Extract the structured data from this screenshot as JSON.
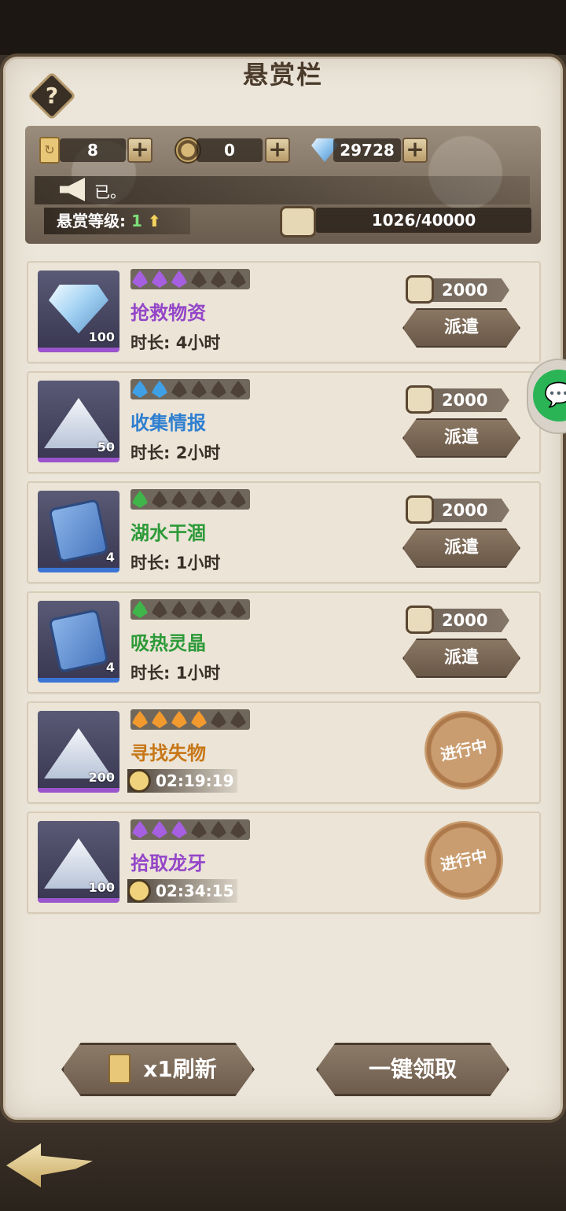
{
  "title": "悬赏栏",
  "help_label": "?",
  "resources": {
    "tickets": "8",
    "coins": "0",
    "gems": "29728",
    "plus": "+"
  },
  "notice": "已。",
  "level": {
    "label": "悬赏等级:",
    "value": "1",
    "arrow": "⬆"
  },
  "exp": "1026/40000",
  "duration_label": "时长:",
  "dispatch_label": "派遣",
  "in_progress_label": "进行中",
  "quests": [
    {
      "name": "抢救物资",
      "duration": "4小时",
      "reward": "2000",
      "qty": "100",
      "stars": 3,
      "star_color": "#a65fe0",
      "name_color": "#9446c8"
    },
    {
      "name": "收集情报",
      "duration": "2小时",
      "reward": "2000",
      "qty": "50",
      "stars": 2,
      "star_color": "#3fa0e6",
      "name_color": "#2f7fd0"
    },
    {
      "name": "湖水干涸",
      "duration": "1小时",
      "reward": "2000",
      "qty": "4",
      "stars": 1,
      "star_color": "#3fb54a",
      "name_color": "#2d9a38"
    },
    {
      "name": "吸热灵晶",
      "duration": "1小时",
      "reward": "2000",
      "qty": "4",
      "stars": 1,
      "star_color": "#3fb54a",
      "name_color": "#2d9a38"
    },
    {
      "name": "寻找失物",
      "timer": "02:19:19",
      "qty": "200",
      "stars": 4,
      "star_color": "#f29a2e",
      "name_color": "#c77718"
    },
    {
      "name": "拾取龙牙",
      "timer": "02:34:15",
      "qty": "100",
      "stars": 3,
      "star_color": "#a65fe0",
      "name_color": "#9446c8"
    }
  ],
  "buttons": {
    "refresh": "x1刷新",
    "claim_all": "一键领取"
  },
  "colors": {
    "panel": "#ece6da",
    "dark_frame": "#3a3128",
    "button": "#7a6856",
    "star_empty": "#4e4238"
  },
  "icons": [
    "help-icon",
    "ticket-icon",
    "coin-icon",
    "gem-icon",
    "horn-icon",
    "scroll-icon",
    "clock-icon",
    "chat-icon",
    "back-arrow-icon"
  ]
}
